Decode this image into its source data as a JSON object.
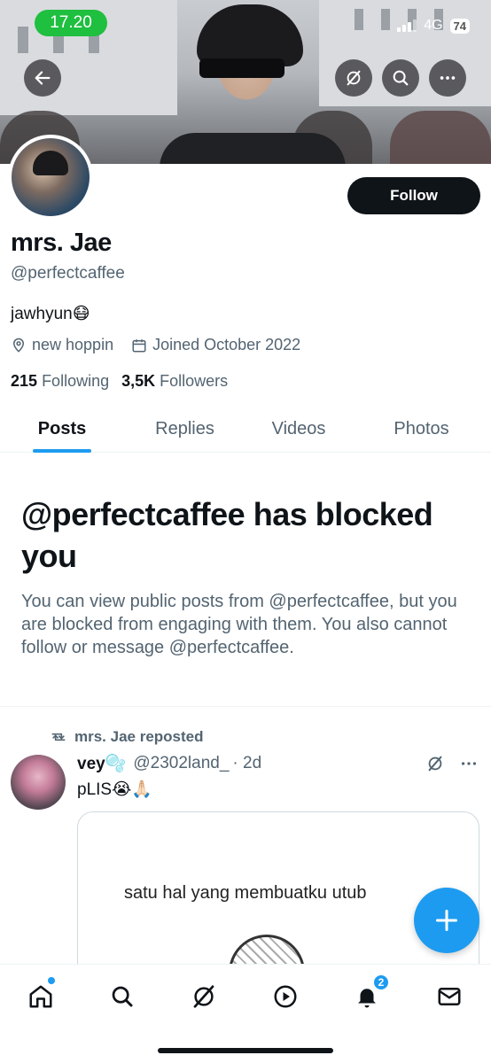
{
  "status_bar": {
    "time": "17.20",
    "network": "4G",
    "battery": "74"
  },
  "profile": {
    "display_name": "mrs. Jae",
    "handle": "@perfectcaffee",
    "bio": "jawhyun😷",
    "location": "new hoppin",
    "joined": "Joined October 2022",
    "following_count": "215",
    "following_label": "Following",
    "followers_count": "3,5K",
    "followers_label": "Followers",
    "follow_label": "Follow"
  },
  "tabs": [
    {
      "label": "Posts",
      "active": true
    },
    {
      "label": "Replies",
      "active": false
    },
    {
      "label": "Videos",
      "active": false
    },
    {
      "label": "Photos",
      "active": false
    }
  ],
  "blocked": {
    "title": "@perfectcaffee has blocked you",
    "text": "You can view public posts from @perfectcaffee, but you are blocked from engaging with them. You also cannot follow or message @perfectcaffee."
  },
  "post": {
    "repost_label": "mrs. Jae reposted",
    "author_name": "vey🫧",
    "author_handle": "@2302land_",
    "time": "· 2d",
    "text": "pLIS😭🙏🏻",
    "media_text": "satu hal yang membuatku utub"
  },
  "nav": {
    "notifications_badge": "2"
  },
  "colors": {
    "accent": "#1d9bf0",
    "time_pill": "#1fbf3f",
    "follow_button": "#0f1419"
  }
}
